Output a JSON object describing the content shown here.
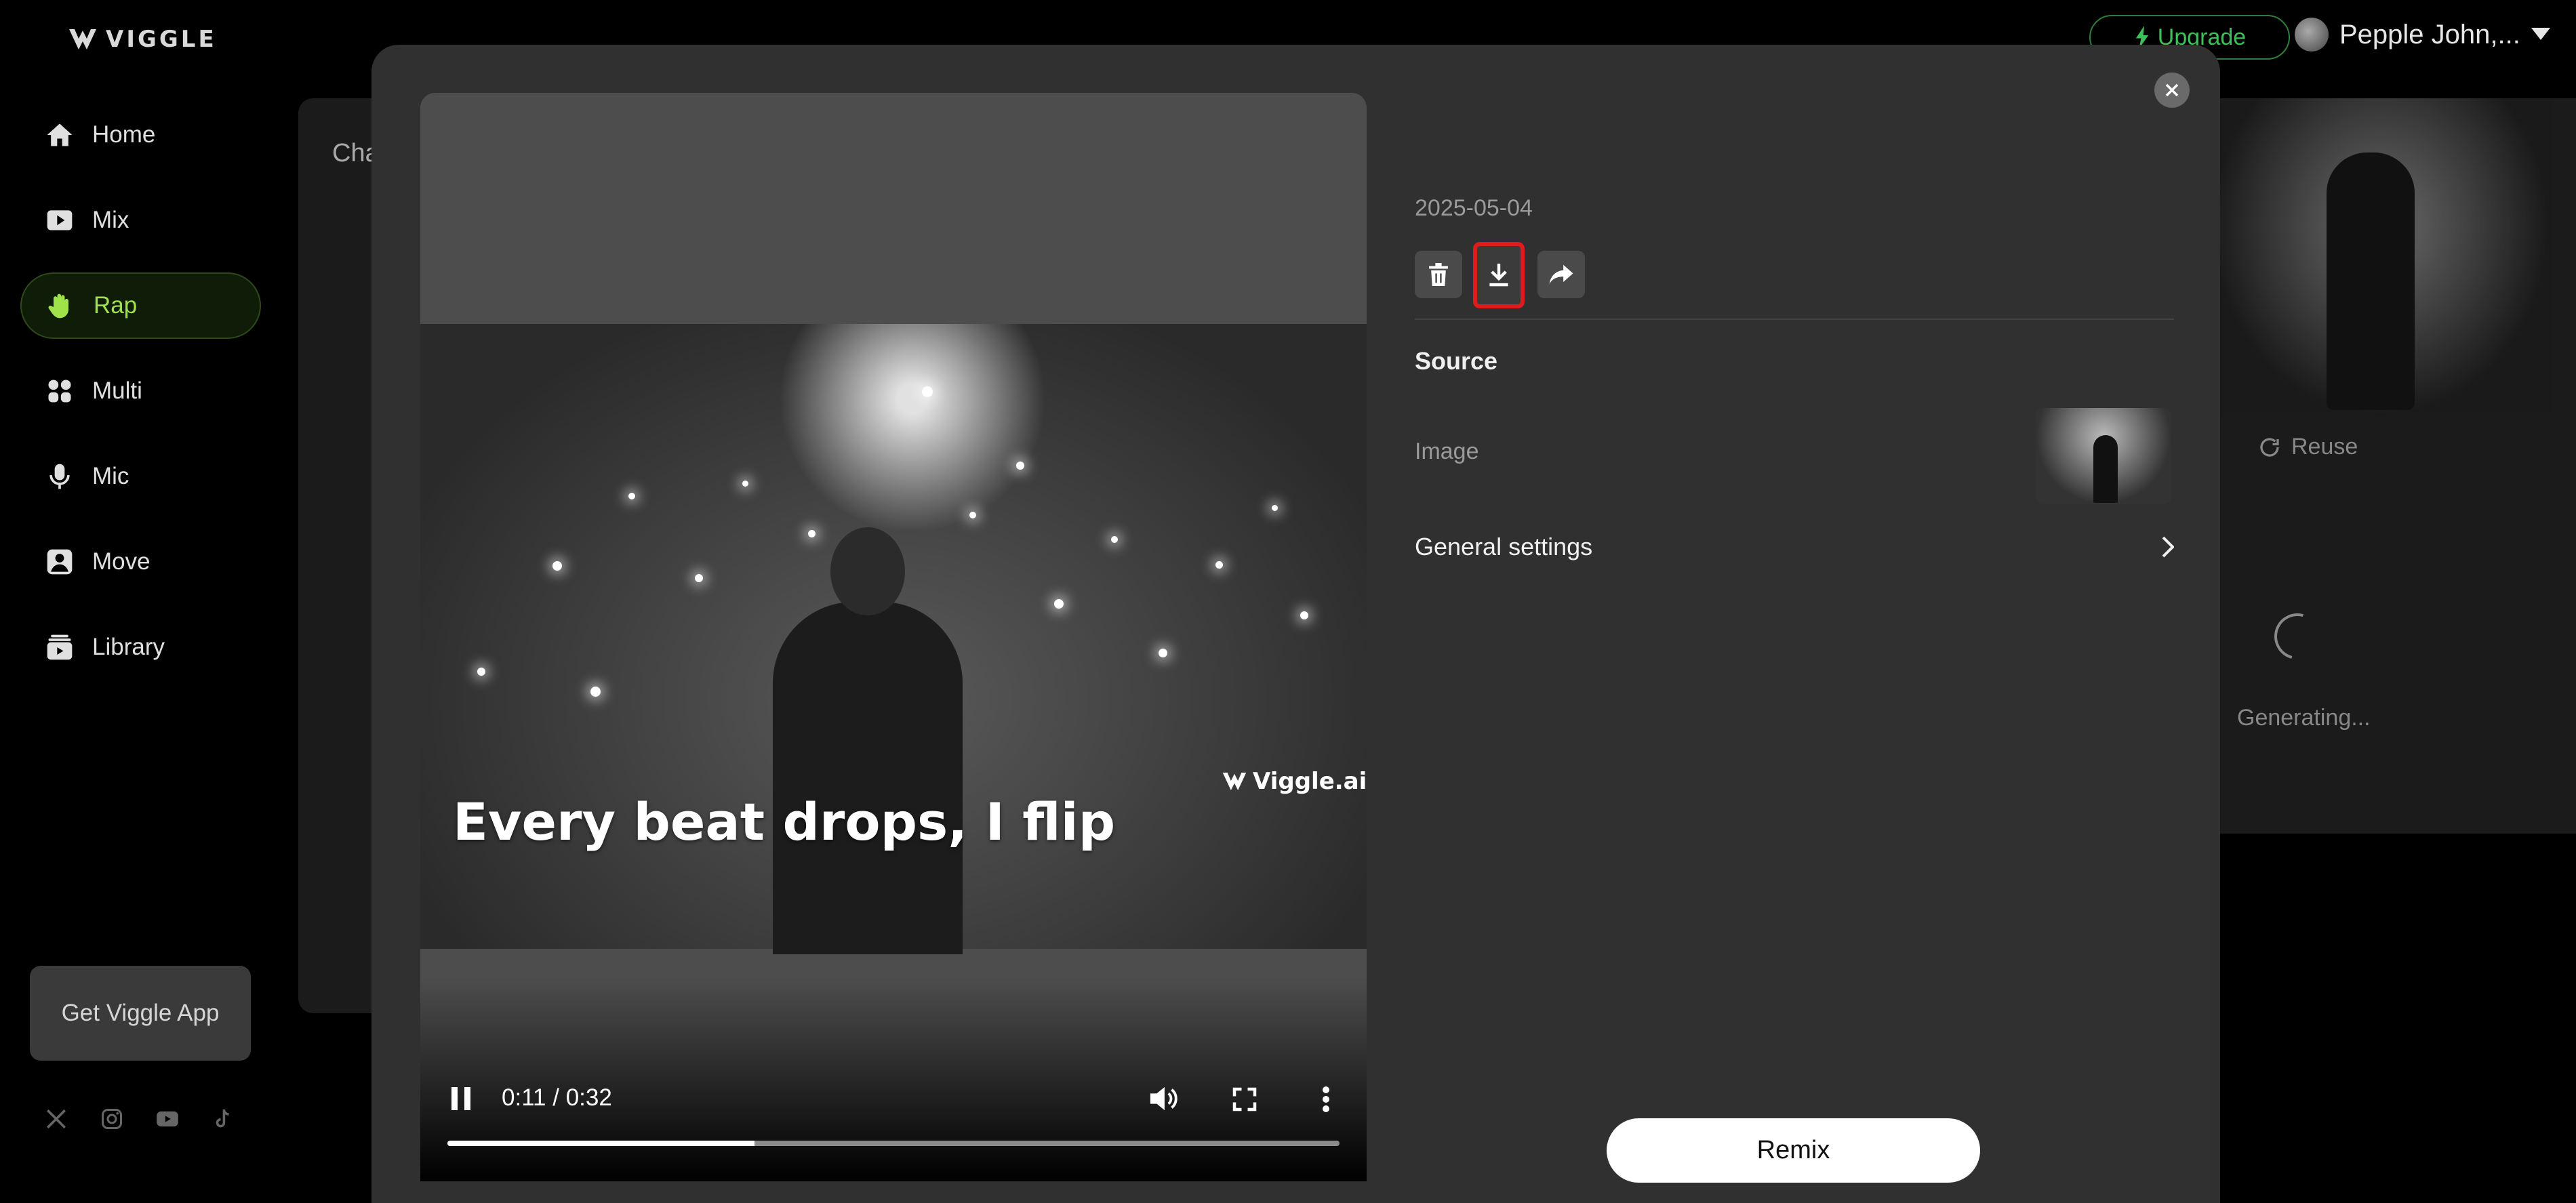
{
  "app": {
    "logo_text": "VIGGLE"
  },
  "sidebar": {
    "items": [
      {
        "label": "Home",
        "icon": "home-icon"
      },
      {
        "label": "Mix",
        "icon": "play-icon"
      },
      {
        "label": "Rap",
        "icon": "hand-icon",
        "active": true
      },
      {
        "label": "Multi",
        "icon": "multi-icon"
      },
      {
        "label": "Mic",
        "icon": "mic-icon"
      },
      {
        "label": "Move",
        "icon": "person-icon"
      },
      {
        "label": "Library",
        "icon": "library-icon"
      }
    ],
    "app_card": "Get Viggle App",
    "socials": [
      "x-icon",
      "instagram-icon",
      "youtube-icon",
      "tiktok-icon"
    ]
  },
  "topbar": {
    "upgrade_label": "Upgrade",
    "user_name": "Pepple John,..."
  },
  "background": {
    "panel_title_fragment": "Cha",
    "reuse_label": "Reuse",
    "generating_label": "Generating..."
  },
  "modal": {
    "video": {
      "caption": "Every beat drops, I flip",
      "watermark": "Viggle.ai",
      "time": "0:11 / 0:32",
      "progress": 0.344
    },
    "details": {
      "date": "2025-05-04",
      "source_heading": "Source",
      "image_label": "Image",
      "general_settings": "General settings",
      "remix_label": "Remix"
    }
  },
  "colors": {
    "accent_green": "#9fe24a",
    "upgrade_green": "#3fbf5a",
    "highlight_red": "#e01b1b",
    "modal_bg": "#303030"
  }
}
